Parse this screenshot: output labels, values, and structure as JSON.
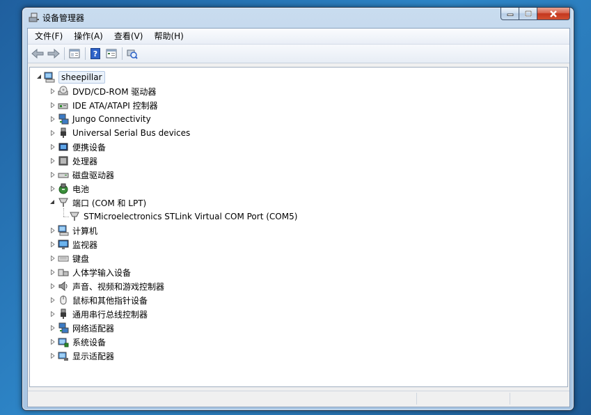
{
  "window": {
    "title": "设备管理器",
    "colors": {
      "title_bar": "#b7cfe7",
      "close_button": "#c4371f",
      "tree_background": "#ffffff"
    }
  },
  "caption_buttons": {
    "minimize": "minimize-icon",
    "maximize": "maximize-icon",
    "close": "close-icon"
  },
  "menu": {
    "items": [
      "文件(F)",
      "操作(A)",
      "查看(V)",
      "帮助(H)"
    ]
  },
  "toolbar": {
    "buttons": [
      "back-arrow-icon",
      "forward-arrow-icon",
      "properties-icon",
      "help-icon",
      "view-icon",
      "scan-hardware-icon"
    ]
  },
  "tree": {
    "root": {
      "label": "sheepillar",
      "icon": "computer-icon",
      "expanded": true
    },
    "items": [
      {
        "label": "DVD/CD-ROM 驱动器",
        "icon": "dvd-drive-icon",
        "expanded": false
      },
      {
        "label": "IDE ATA/ATAPI 控制器",
        "icon": "ide-controller-icon",
        "expanded": false
      },
      {
        "label": "Jungo Connectivity",
        "icon": "network-device-icon",
        "expanded": false
      },
      {
        "label": "Universal Serial Bus devices",
        "icon": "usb-plug-icon",
        "expanded": false
      },
      {
        "label": "便携设备",
        "icon": "portable-device-icon",
        "expanded": false
      },
      {
        "label": "处理器",
        "icon": "processor-icon",
        "expanded": false
      },
      {
        "label": "磁盘驱动器",
        "icon": "disk-drive-icon",
        "expanded": false
      },
      {
        "label": "电池",
        "icon": "battery-icon",
        "expanded": false
      },
      {
        "label": "端口 (COM 和 LPT)",
        "icon": "port-icon",
        "expanded": true,
        "children": [
          {
            "label": "STMicroelectronics STLink Virtual COM Port (COM5)",
            "icon": "port-icon"
          }
        ]
      },
      {
        "label": "计算机",
        "icon": "computer-icon",
        "expanded": false
      },
      {
        "label": "监视器",
        "icon": "monitor-icon",
        "expanded": false
      },
      {
        "label": "键盘",
        "icon": "keyboard-icon",
        "expanded": false
      },
      {
        "label": "人体学输入设备",
        "icon": "hid-icon",
        "expanded": false
      },
      {
        "label": "声音、视频和游戏控制器",
        "icon": "speaker-icon",
        "expanded": false
      },
      {
        "label": "鼠标和其他指针设备",
        "icon": "mouse-icon",
        "expanded": false
      },
      {
        "label": "通用串行总线控制器",
        "icon": "usb-plug-icon",
        "expanded": false
      },
      {
        "label": "网络适配器",
        "icon": "network-adapter-icon",
        "expanded": false
      },
      {
        "label": "系统设备",
        "icon": "system-device-icon",
        "expanded": false
      },
      {
        "label": "显示适配器",
        "icon": "display-adapter-icon",
        "expanded": false
      }
    ]
  }
}
